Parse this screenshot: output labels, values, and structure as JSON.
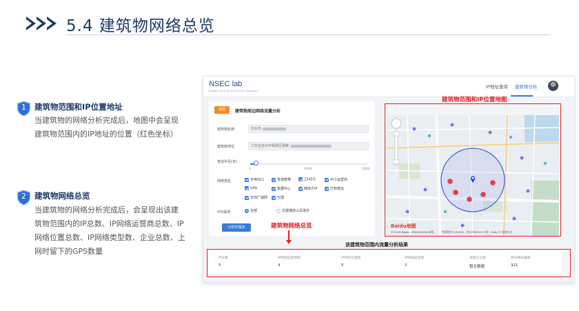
{
  "header": {
    "title": "5.4 建筑物网络总览"
  },
  "bullets": [
    {
      "number": "1",
      "heading": "建筑物范围和IP位置地址",
      "lines": [
        "当建筑物的网络分析完成后，地图中会呈现",
        "建筑物范围内的IP地址的位置（红色坐标）"
      ]
    },
    {
      "number": "2",
      "heading": "建筑物网络总览",
      "lines": [
        "当建筑物的网络分析完成后，会呈现出该建",
        "筑物范围内的IP总数、IP网络运营商总数、IP",
        "网络位置总数、IP网络类型数、企业总数、上",
        "网时留下的GPS数量"
      ]
    }
  ],
  "app": {
    "logo": "NSEC lab",
    "logo_sub": "Network Security and Privacy Laboratory",
    "nav": [
      "IP地址查询",
      "建筑物分析"
    ],
    "return_label": "返回",
    "form_title": "建筑物周边网络流量分析",
    "fields": [
      {
        "label": "建筑物名称",
        "value": "苏州市"
      },
      {
        "label": "建筑物地址",
        "value": "江苏省苏州市相城区相峰"
      }
    ],
    "radius": {
      "label": "查找半径(米)",
      "ticks": [
        "0",
        "1000",
        "2000"
      ],
      "value": 100,
      "max": 2000
    },
    "network_type": {
      "label": "网络类型",
      "options": [
        "专用出口",
        "普通宽带",
        "2345G",
        "中小运营商",
        "VPN",
        "数据中心",
        "媒体方IP",
        "已知爬虫",
        "无线广域网",
        "代理"
      ]
    },
    "ip_scope": {
      "label": "IP归属地",
      "options": [
        "全部",
        "仅建播自以及境外"
      ],
      "selected": 0
    },
    "submit_label": "分析并保存",
    "map_logo": "Baidu地图",
    "map_credit": "© 2020 Baidu - GS(2019)5218号 -",
    "map_credit2": "甲测资字1100930 - 京ICP证030173号 - Data © 长地万方",
    "results_title": "该建筑物范围内流量分析结果",
    "stats": [
      {
        "label": "IP总数",
        "value": "5"
      },
      {
        "label": "IP网络运营商数",
        "value": "4"
      },
      {
        "label": "IP网络位置数",
        "value": "5"
      },
      {
        "label": "IP网络类型数",
        "value": "2"
      },
      {
        "label": "关联企业数",
        "value": "暂无数据"
      },
      {
        "label": "移动端设备数",
        "value": "321"
      }
    ]
  },
  "callouts": {
    "map": "建筑物范围和IP位置地图",
    "overview": "建筑物网络总览"
  },
  "colors": {
    "brand": "#1b3a6b",
    "accent": "#3a7bd5",
    "alert": "#e02020",
    "return": "#f58a1f"
  }
}
